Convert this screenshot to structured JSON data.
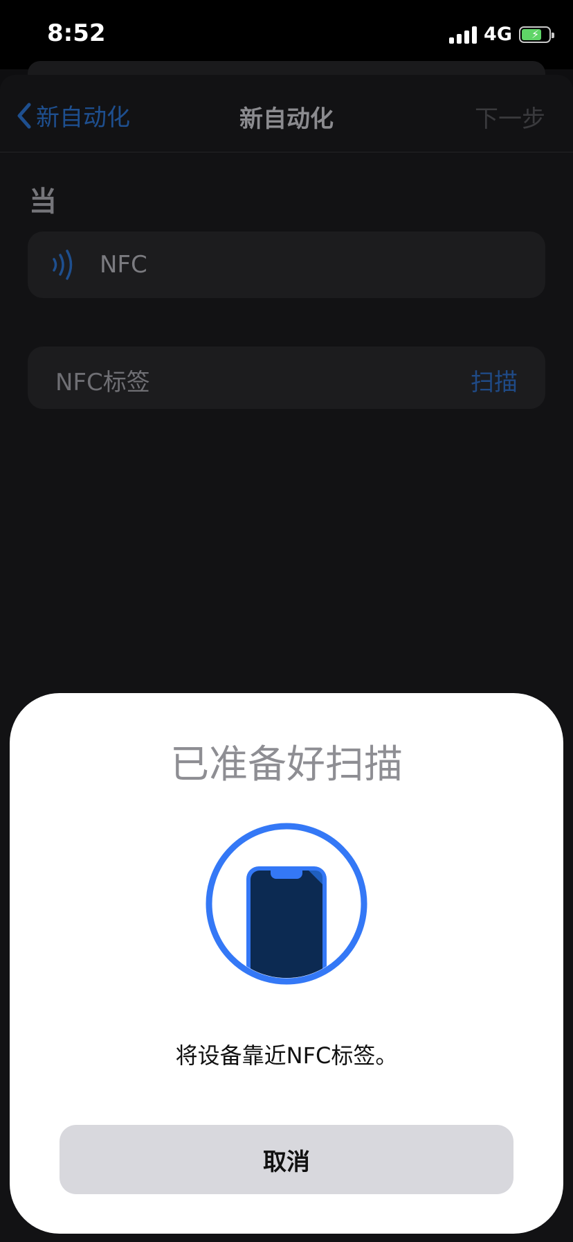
{
  "status_bar": {
    "time": "8:52",
    "network": "4G",
    "icons": [
      "signal-icon",
      "battery-charging-icon"
    ]
  },
  "navbar": {
    "back_label": "新自动化",
    "title": "新自动化",
    "next_label": "下一步"
  },
  "section": {
    "label": "当"
  },
  "trigger_row": {
    "icon": "nfc-icon",
    "label": "NFC"
  },
  "tag_row": {
    "label": "NFC标签",
    "action": "扫描"
  },
  "scan_sheet": {
    "title": "已准备好扫描",
    "message": "将设备靠近NFC标签。",
    "cancel_label": "取消",
    "illustration": "phone-nfc-icon"
  },
  "colors": {
    "accent": "#3478f6",
    "sheet_background": "#ffffff",
    "button_background": "#d8d8dd"
  }
}
